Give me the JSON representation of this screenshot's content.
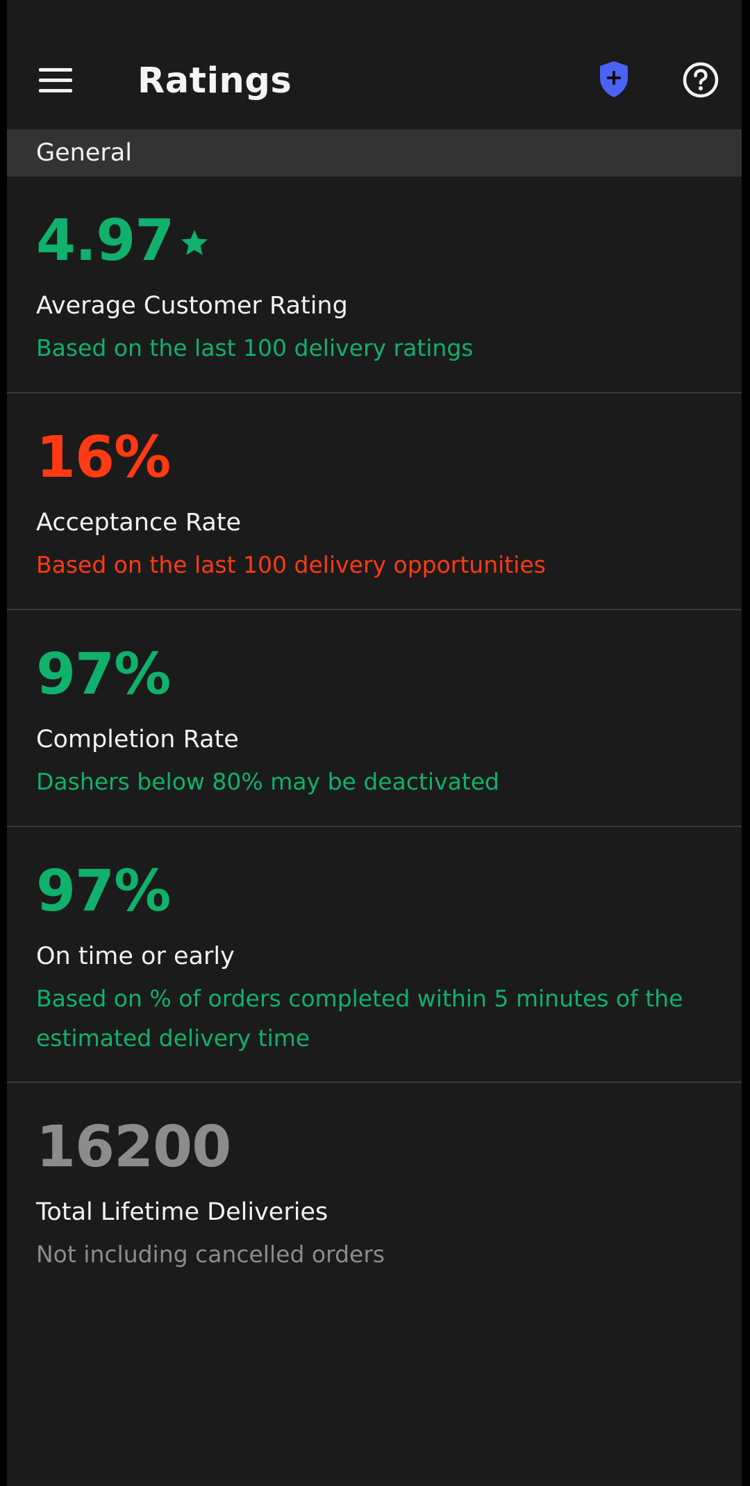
{
  "header": {
    "title": "Ratings"
  },
  "icons": {
    "menu": "hamburger-menu-icon",
    "safety": "shield-plus-icon",
    "help": "question-circle-icon",
    "rating": "star-icon"
  },
  "section": {
    "label": "General"
  },
  "metrics": [
    {
      "value": "4.97",
      "label": "Average Customer Rating",
      "note": "Based on the last 100 delivery ratings",
      "color": "#10b16b"
    },
    {
      "value": "16%",
      "label": "Acceptance Rate",
      "note": "Based on the last 100 delivery opportunities",
      "color": "#ff3a14"
    },
    {
      "value": "97%",
      "label": "Completion Rate",
      "note": "Dashers below 80% may be deactivated",
      "color": "#10b16b"
    },
    {
      "value": "97%",
      "label": "On time or early",
      "note": "Based on % of orders completed within 5 minutes of the estimated delivery time",
      "color": "#10b16b"
    },
    {
      "value": "16200",
      "label": "Total Lifetime Deliveries",
      "note": "Not including cancelled orders",
      "color": "#8c8c8c"
    }
  ],
  "colors": {
    "background": "#1b1b1b",
    "section_bar": "#333333",
    "divider": "#3a3a3a",
    "good": "#10b16b",
    "bad": "#ff3a14",
    "neutral": "#8c8c8c",
    "shield": "#4a63f4"
  }
}
